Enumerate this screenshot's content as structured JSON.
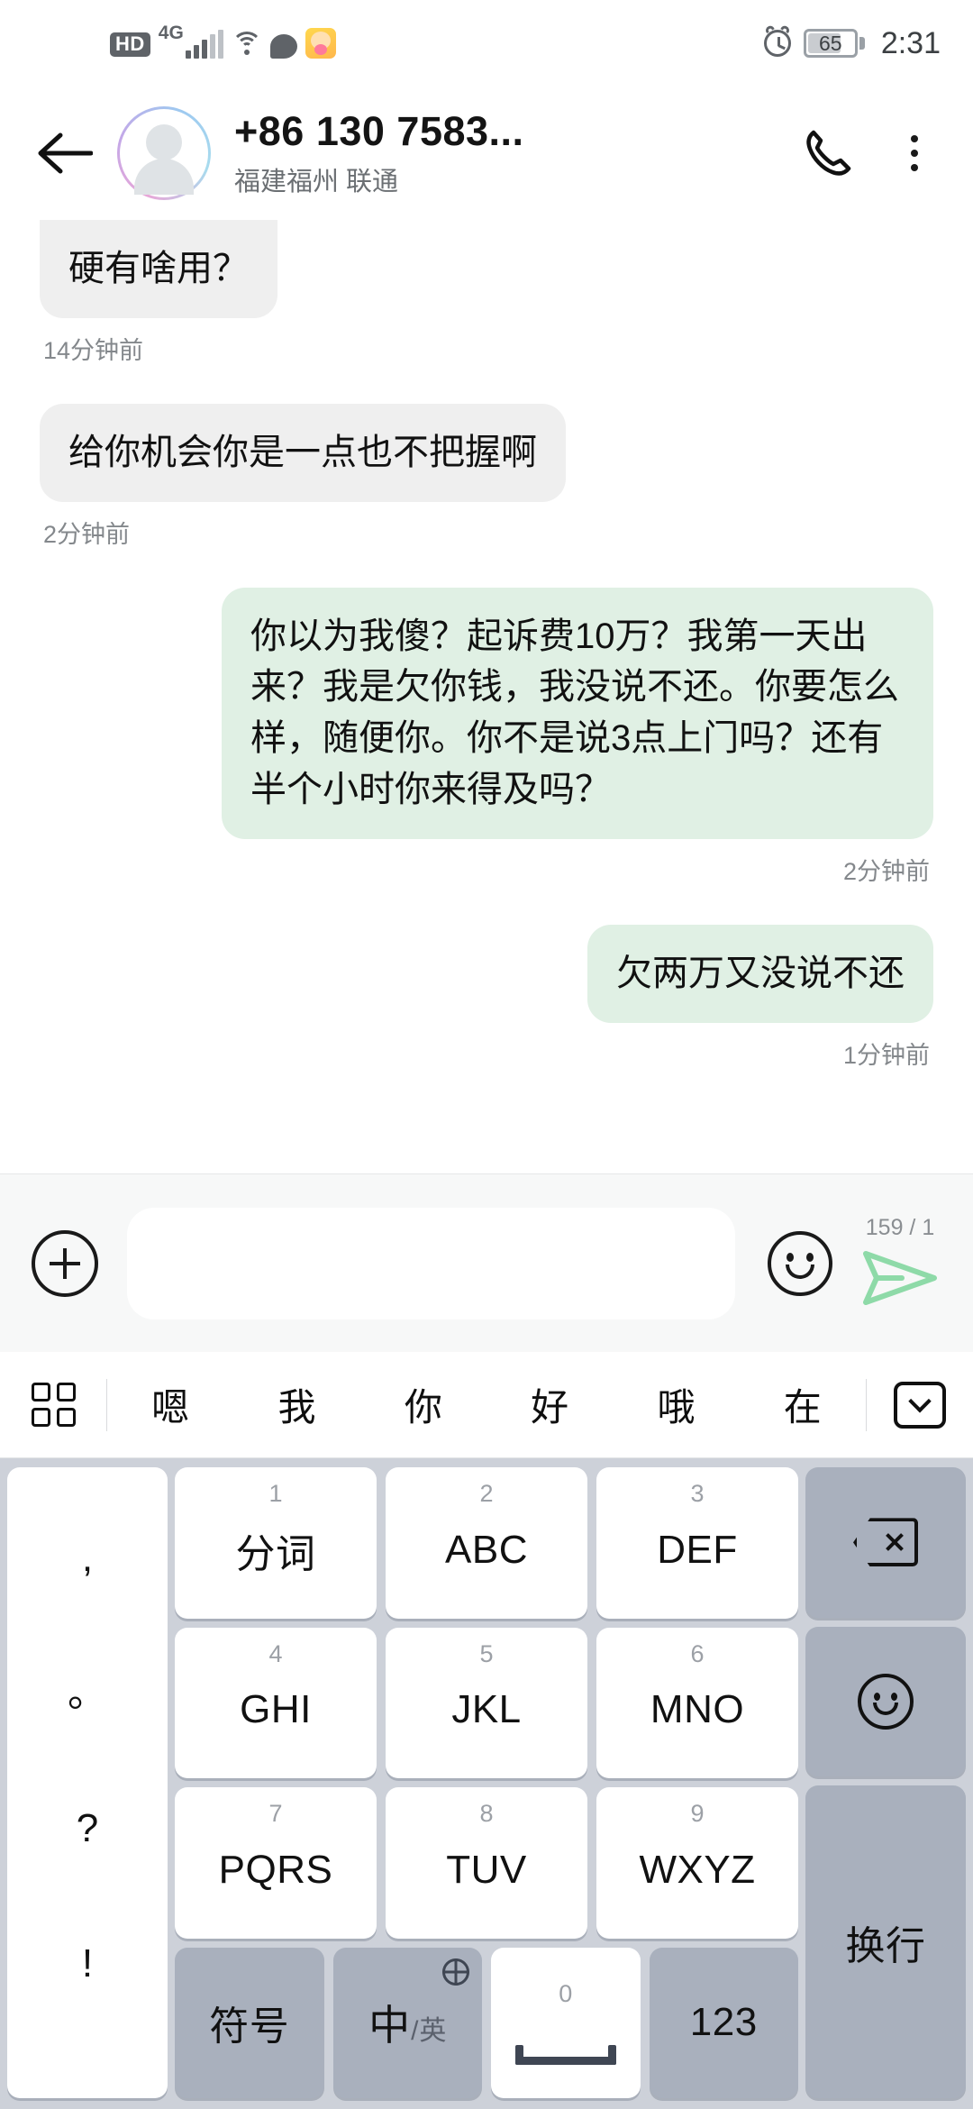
{
  "status_bar": {
    "hd_label": "HD",
    "network_label": "4G",
    "signal_icon": "signal-bars-icon",
    "wifi_icon": "wifi-icon",
    "message_icon": "chat-bubble-icon",
    "app_icon": "app-notification-icon",
    "alarm_icon": "alarm-clock-icon",
    "battery_level": "65",
    "time": "2:31"
  },
  "header": {
    "back_icon": "back-arrow-icon",
    "avatar_icon": "contact-avatar-icon",
    "title": "+86 130 7583...",
    "subtitle": "福建福州 联通",
    "call_icon": "phone-call-icon",
    "more_icon": "more-options-icon"
  },
  "chat": {
    "messages": [
      {
        "direction": "in",
        "text": "硬有啥用？",
        "time": "14分钟前",
        "clipped": true
      },
      {
        "direction": "in",
        "text": "给你机会你是一点也不把握啊",
        "time": "2分钟前",
        "clipped": false
      },
      {
        "direction": "out",
        "text": "你以为我傻？起诉费10万？我第一天出来？我是欠你钱，我没说不还。你要怎么样，随便你。你不是说3点上门吗？还有半个小时你来得及吗？",
        "time": "2分钟前",
        "clipped": false
      },
      {
        "direction": "out",
        "text": "欠两万又没说不还",
        "time": "1分钟前",
        "clipped": false
      }
    ]
  },
  "input_bar": {
    "add_icon": "plus-circle-icon",
    "text_value": "",
    "text_placeholder": "",
    "emoji_icon": "smiley-face-icon",
    "counter": "159 / 1",
    "send_icon": "send-arrow-icon",
    "send_color": "#8edaa8"
  },
  "suggestion_bar": {
    "grid_icon": "keyboard-panel-grid-icon",
    "words": [
      "嗯",
      "我",
      "你",
      "好",
      "哦",
      "在"
    ],
    "collapse_icon": "collapse-keyboard-icon"
  },
  "keyboard": {
    "punctuation": [
      ",",
      "。",
      "?",
      "!"
    ],
    "rows": [
      [
        {
          "num": "1",
          "label": "分词",
          "type": "letter"
        },
        {
          "num": "2",
          "label": "ABC",
          "type": "letter"
        },
        {
          "num": "3",
          "label": "DEF",
          "type": "letter"
        }
      ],
      [
        {
          "num": "4",
          "label": "GHI",
          "type": "letter"
        },
        {
          "num": "5",
          "label": "JKL",
          "type": "letter"
        },
        {
          "num": "6",
          "label": "MNO",
          "type": "letter"
        }
      ],
      [
        {
          "num": "7",
          "label": "PQRS",
          "type": "letter"
        },
        {
          "num": "8",
          "label": "TUV",
          "type": "letter"
        },
        {
          "num": "9",
          "label": "WXYZ",
          "type": "letter"
        }
      ]
    ],
    "bottom_row": {
      "symbol_label": "符号",
      "lang_main": "中",
      "lang_slash": "/",
      "lang_sub": "英",
      "globe_icon": "globe-language-icon",
      "space_num": "0",
      "space_icon": "microphone-icon",
      "numeric_label": "123"
    },
    "right_column": {
      "backspace_icon": "backspace-icon",
      "emoji_icon": "smiley-face-icon",
      "enter_label": "换行"
    }
  }
}
